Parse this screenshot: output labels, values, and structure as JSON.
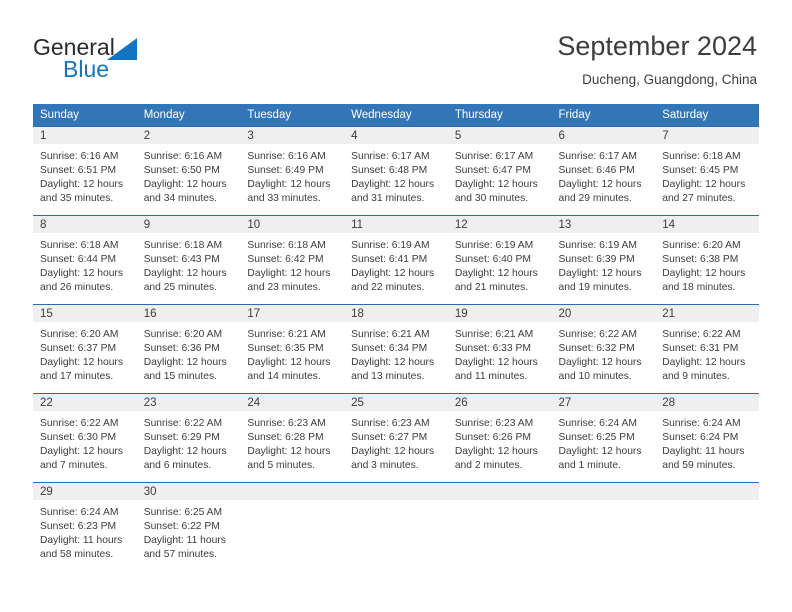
{
  "brand": {
    "name_top": "General",
    "name_bottom": "Blue"
  },
  "header": {
    "title": "September 2024",
    "subtitle": "Ducheng, Guangdong, China"
  },
  "colors": {
    "header_blue": "#3376b8",
    "border_blue": "#2b6cab",
    "daynum_gray": "#efefef",
    "brand_blue": "#1574bb",
    "text": "#3d3d3d"
  },
  "weekday_headers": [
    "Sunday",
    "Monday",
    "Tuesday",
    "Wednesday",
    "Thursday",
    "Friday",
    "Saturday"
  ],
  "weeks": [
    [
      {
        "day": "1",
        "sunrise": "Sunrise: 6:16 AM",
        "sunset": "Sunset: 6:51 PM",
        "daylight_line1": "Daylight: 12 hours",
        "daylight_line2": "and 35 minutes."
      },
      {
        "day": "2",
        "sunrise": "Sunrise: 6:16 AM",
        "sunset": "Sunset: 6:50 PM",
        "daylight_line1": "Daylight: 12 hours",
        "daylight_line2": "and 34 minutes."
      },
      {
        "day": "3",
        "sunrise": "Sunrise: 6:16 AM",
        "sunset": "Sunset: 6:49 PM",
        "daylight_line1": "Daylight: 12 hours",
        "daylight_line2": "and 33 minutes."
      },
      {
        "day": "4",
        "sunrise": "Sunrise: 6:17 AM",
        "sunset": "Sunset: 6:48 PM",
        "daylight_line1": "Daylight: 12 hours",
        "daylight_line2": "and 31 minutes."
      },
      {
        "day": "5",
        "sunrise": "Sunrise: 6:17 AM",
        "sunset": "Sunset: 6:47 PM",
        "daylight_line1": "Daylight: 12 hours",
        "daylight_line2": "and 30 minutes."
      },
      {
        "day": "6",
        "sunrise": "Sunrise: 6:17 AM",
        "sunset": "Sunset: 6:46 PM",
        "daylight_line1": "Daylight: 12 hours",
        "daylight_line2": "and 29 minutes."
      },
      {
        "day": "7",
        "sunrise": "Sunrise: 6:18 AM",
        "sunset": "Sunset: 6:45 PM",
        "daylight_line1": "Daylight: 12 hours",
        "daylight_line2": "and 27 minutes."
      }
    ],
    [
      {
        "day": "8",
        "sunrise": "Sunrise: 6:18 AM",
        "sunset": "Sunset: 6:44 PM",
        "daylight_line1": "Daylight: 12 hours",
        "daylight_line2": "and 26 minutes."
      },
      {
        "day": "9",
        "sunrise": "Sunrise: 6:18 AM",
        "sunset": "Sunset: 6:43 PM",
        "daylight_line1": "Daylight: 12 hours",
        "daylight_line2": "and 25 minutes."
      },
      {
        "day": "10",
        "sunrise": "Sunrise: 6:18 AM",
        "sunset": "Sunset: 6:42 PM",
        "daylight_line1": "Daylight: 12 hours",
        "daylight_line2": "and 23 minutes."
      },
      {
        "day": "11",
        "sunrise": "Sunrise: 6:19 AM",
        "sunset": "Sunset: 6:41 PM",
        "daylight_line1": "Daylight: 12 hours",
        "daylight_line2": "and 22 minutes."
      },
      {
        "day": "12",
        "sunrise": "Sunrise: 6:19 AM",
        "sunset": "Sunset: 6:40 PM",
        "daylight_line1": "Daylight: 12 hours",
        "daylight_line2": "and 21 minutes."
      },
      {
        "day": "13",
        "sunrise": "Sunrise: 6:19 AM",
        "sunset": "Sunset: 6:39 PM",
        "daylight_line1": "Daylight: 12 hours",
        "daylight_line2": "and 19 minutes."
      },
      {
        "day": "14",
        "sunrise": "Sunrise: 6:20 AM",
        "sunset": "Sunset: 6:38 PM",
        "daylight_line1": "Daylight: 12 hours",
        "daylight_line2": "and 18 minutes."
      }
    ],
    [
      {
        "day": "15",
        "sunrise": "Sunrise: 6:20 AM",
        "sunset": "Sunset: 6:37 PM",
        "daylight_line1": "Daylight: 12 hours",
        "daylight_line2": "and 17 minutes."
      },
      {
        "day": "16",
        "sunrise": "Sunrise: 6:20 AM",
        "sunset": "Sunset: 6:36 PM",
        "daylight_line1": "Daylight: 12 hours",
        "daylight_line2": "and 15 minutes."
      },
      {
        "day": "17",
        "sunrise": "Sunrise: 6:21 AM",
        "sunset": "Sunset: 6:35 PM",
        "daylight_line1": "Daylight: 12 hours",
        "daylight_line2": "and 14 minutes."
      },
      {
        "day": "18",
        "sunrise": "Sunrise: 6:21 AM",
        "sunset": "Sunset: 6:34 PM",
        "daylight_line1": "Daylight: 12 hours",
        "daylight_line2": "and 13 minutes."
      },
      {
        "day": "19",
        "sunrise": "Sunrise: 6:21 AM",
        "sunset": "Sunset: 6:33 PM",
        "daylight_line1": "Daylight: 12 hours",
        "daylight_line2": "and 11 minutes."
      },
      {
        "day": "20",
        "sunrise": "Sunrise: 6:22 AM",
        "sunset": "Sunset: 6:32 PM",
        "daylight_line1": "Daylight: 12 hours",
        "daylight_line2": "and 10 minutes."
      },
      {
        "day": "21",
        "sunrise": "Sunrise: 6:22 AM",
        "sunset": "Sunset: 6:31 PM",
        "daylight_line1": "Daylight: 12 hours",
        "daylight_line2": "and 9 minutes."
      }
    ],
    [
      {
        "day": "22",
        "sunrise": "Sunrise: 6:22 AM",
        "sunset": "Sunset: 6:30 PM",
        "daylight_line1": "Daylight: 12 hours",
        "daylight_line2": "and 7 minutes."
      },
      {
        "day": "23",
        "sunrise": "Sunrise: 6:22 AM",
        "sunset": "Sunset: 6:29 PM",
        "daylight_line1": "Daylight: 12 hours",
        "daylight_line2": "and 6 minutes."
      },
      {
        "day": "24",
        "sunrise": "Sunrise: 6:23 AM",
        "sunset": "Sunset: 6:28 PM",
        "daylight_line1": "Daylight: 12 hours",
        "daylight_line2": "and 5 minutes."
      },
      {
        "day": "25",
        "sunrise": "Sunrise: 6:23 AM",
        "sunset": "Sunset: 6:27 PM",
        "daylight_line1": "Daylight: 12 hours",
        "daylight_line2": "and 3 minutes."
      },
      {
        "day": "26",
        "sunrise": "Sunrise: 6:23 AM",
        "sunset": "Sunset: 6:26 PM",
        "daylight_line1": "Daylight: 12 hours",
        "daylight_line2": "and 2 minutes."
      },
      {
        "day": "27",
        "sunrise": "Sunrise: 6:24 AM",
        "sunset": "Sunset: 6:25 PM",
        "daylight_line1": "Daylight: 12 hours",
        "daylight_line2": "and 1 minute."
      },
      {
        "day": "28",
        "sunrise": "Sunrise: 6:24 AM",
        "sunset": "Sunset: 6:24 PM",
        "daylight_line1": "Daylight: 11 hours",
        "daylight_line2": "and 59 minutes."
      }
    ],
    [
      {
        "day": "29",
        "sunrise": "Sunrise: 6:24 AM",
        "sunset": "Sunset: 6:23 PM",
        "daylight_line1": "Daylight: 11 hours",
        "daylight_line2": "and 58 minutes."
      },
      {
        "day": "30",
        "sunrise": "Sunrise: 6:25 AM",
        "sunset": "Sunset: 6:22 PM",
        "daylight_line1": "Daylight: 11 hours",
        "daylight_line2": "and 57 minutes."
      },
      {
        "day": "",
        "sunrise": "",
        "sunset": "",
        "daylight_line1": "",
        "daylight_line2": ""
      },
      {
        "day": "",
        "sunrise": "",
        "sunset": "",
        "daylight_line1": "",
        "daylight_line2": ""
      },
      {
        "day": "",
        "sunrise": "",
        "sunset": "",
        "daylight_line1": "",
        "daylight_line2": ""
      },
      {
        "day": "",
        "sunrise": "",
        "sunset": "",
        "daylight_line1": "",
        "daylight_line2": ""
      },
      {
        "day": "",
        "sunrise": "",
        "sunset": "",
        "daylight_line1": "",
        "daylight_line2": ""
      }
    ]
  ]
}
